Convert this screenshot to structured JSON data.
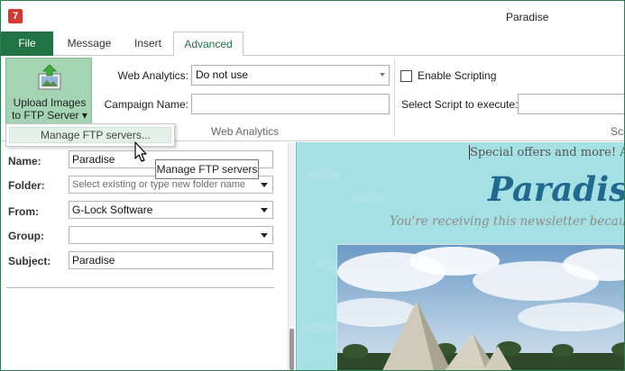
{
  "window": {
    "title": "Paradise"
  },
  "tabs": [
    {
      "label": "File"
    },
    {
      "label": "Message"
    },
    {
      "label": "Insert"
    },
    {
      "label": "Advanced"
    }
  ],
  "ribbon": {
    "upload_button": {
      "line1": "Upload Images",
      "line2": "to FTP Server ▾"
    },
    "web_analytics": {
      "analytics_label": "Web Analytics:",
      "analytics_value": "Do not use",
      "campaign_label": "Campaign Name:",
      "campaign_value": "",
      "group_label": "Web Analytics"
    },
    "scripting": {
      "enable_label": "Enable Scripting",
      "enabled": false,
      "select_label": "Select Script to execute:",
      "select_value": "",
      "group_label_fragment": "Scr"
    }
  },
  "popup_menu": {
    "items": [
      {
        "label": "Manage FTP servers..."
      }
    ]
  },
  "tooltip": {
    "text": "Manage FTP servers"
  },
  "form": {
    "name_label": "Name:",
    "name_value": "Paradise",
    "folder_label": "Folder:",
    "folder_placeholder": "Select existing or type new folder name",
    "from_label": "From:",
    "from_value": "G-Lock Software",
    "group_label": "Group:",
    "group_value": "",
    "subject_label": "Subject:",
    "subject_value": "Paradise"
  },
  "preview": {
    "special_offers": "Special offers and more! A ni",
    "brand": "Paradise",
    "receiving": "You're receiving this newsletter because"
  },
  "colors": {
    "accent_green": "#217346",
    "upload_button_bg": "#a5d4b4",
    "preview_bg": "#a5e0e4",
    "brand_blue": "#1f6a8e"
  }
}
